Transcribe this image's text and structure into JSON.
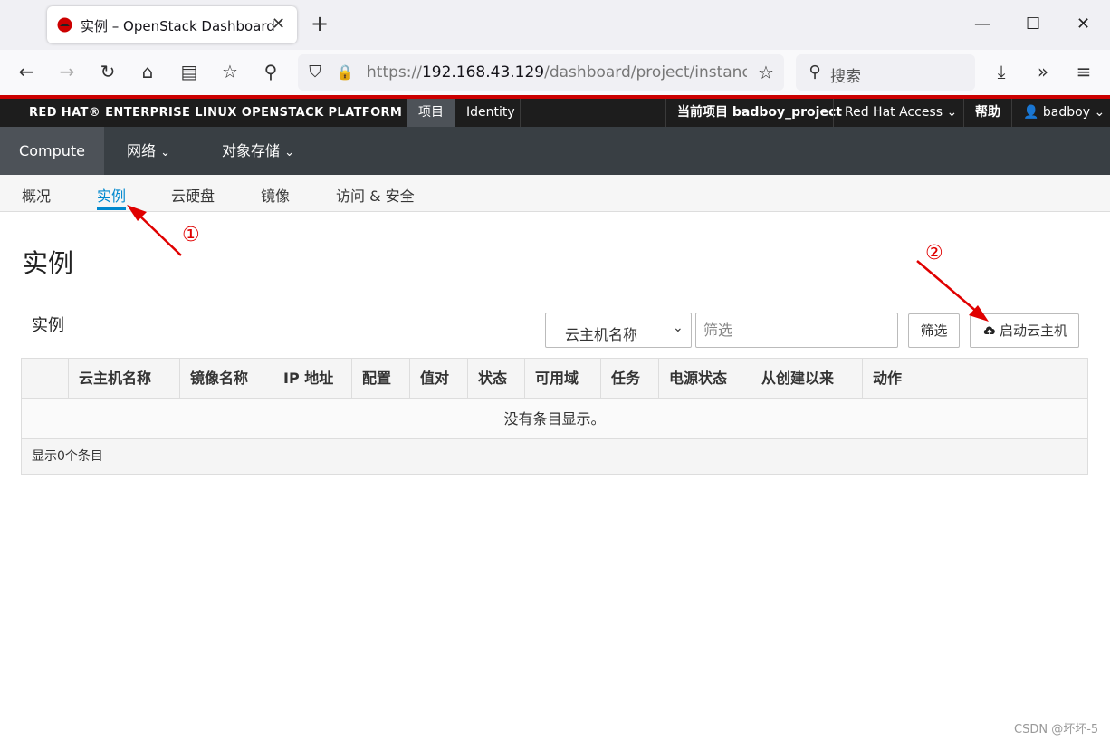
{
  "browser": {
    "tab_title": "实例 – OpenStack Dashboard",
    "url_prefix": "https://",
    "url_host": "192.168.43.129",
    "url_path": "/dashboard/project/instances",
    "search_placeholder": "搜索"
  },
  "topbar": {
    "brand": "RED HAT® ENTERPRISE LINUX OPENSTACK PLATFORM",
    "project_tab": "项目",
    "identity_tab": "Identity",
    "current_project": "当前项目 badboy_project",
    "redhat_access": "Red Hat Access",
    "help": "帮助",
    "user": "badboy"
  },
  "second_nav": {
    "compute": "Compute",
    "network": "网络",
    "object_storage": "对象存储"
  },
  "third_nav": {
    "overview": "概况",
    "instances": "实例",
    "volumes": "云硬盘",
    "images": "镜像",
    "access_security": "访问 & 安全"
  },
  "page": {
    "title": "实例",
    "section_title": "实例",
    "filter_select_value": "云主机名称",
    "filter_placeholder": "筛选",
    "filter_button": "筛选",
    "launch_button": "启动云主机"
  },
  "table": {
    "columns": [
      "云主机名称",
      "镜像名称",
      "IP 地址",
      "配置",
      "值对",
      "状态",
      "可用域",
      "任务",
      "电源状态",
      "从创建以来",
      "动作"
    ],
    "empty_message": "没有条目显示。",
    "footer": "显示0个条目"
  },
  "annotations": {
    "marker1": "①",
    "marker2": "②"
  },
  "watermark": "CSDN @坏坏-5",
  "colors": {
    "accent_red": "#cc0000",
    "active_blue": "#0088ce",
    "annotation_red": "#e00000"
  }
}
